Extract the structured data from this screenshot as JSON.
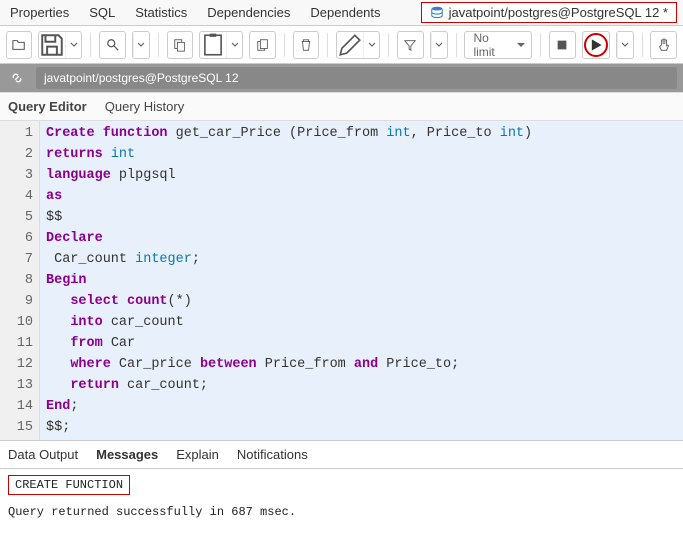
{
  "top_tabs": {
    "properties": "Properties",
    "sql": "SQL",
    "statistics": "Statistics",
    "dependencies": "Dependencies",
    "dependents": "Dependents"
  },
  "db_tab": "javatpoint/postgres@PostgreSQL 12 *",
  "toolbar": {
    "limit": "No limit"
  },
  "connection": "javatpoint/postgres@PostgreSQL 12",
  "sub_tabs": {
    "query_editor": "Query Editor",
    "query_history": "Query History"
  },
  "code": {
    "gutter": "1\n2\n3\n4\n5\n6\n7\n8\n9\n10\n11\n12\n13\n14\n15",
    "lines": {
      "l1_a": "Create function",
      "l1_b": " get_car_Price (Price_from ",
      "l1_c": "int",
      "l1_d": ", Price_to ",
      "l1_e": "int",
      "l1_f": ")",
      "l2_a": "returns",
      "l2_b": " int",
      "l3_a": "language",
      "l3_b": " plpgsql",
      "l4_a": "as",
      "l5_a": "$$",
      "l6_a": "Declare",
      "l7_a": " Car_count ",
      "l7_b": "integer",
      "l7_c": ";",
      "l8_a": "Begin",
      "l9_a": "   ",
      "l9_b": "select",
      "l9_c": " count",
      "l9_d": "(*)",
      "l10_a": "   ",
      "l10_b": "into",
      "l10_c": " car_count",
      "l11_a": "   ",
      "l11_b": "from",
      "l11_c": " Car",
      "l12_a": "   ",
      "l12_b": "where",
      "l12_c": " Car_price ",
      "l12_d": "between",
      "l12_e": " Price_from ",
      "l12_f": "and",
      "l12_g": " Price_to;",
      "l13_a": "   ",
      "l13_b": "return",
      "l13_c": " car_count;",
      "l14_a": "End",
      "l14_b": ";",
      "l15_a": "$$;"
    }
  },
  "out_tabs": {
    "data_output": "Data Output",
    "messages": "Messages",
    "explain": "Explain",
    "notifications": "Notifications"
  },
  "output": {
    "result": "CREATE FUNCTION",
    "status": "Query returned successfully in 687 msec."
  }
}
